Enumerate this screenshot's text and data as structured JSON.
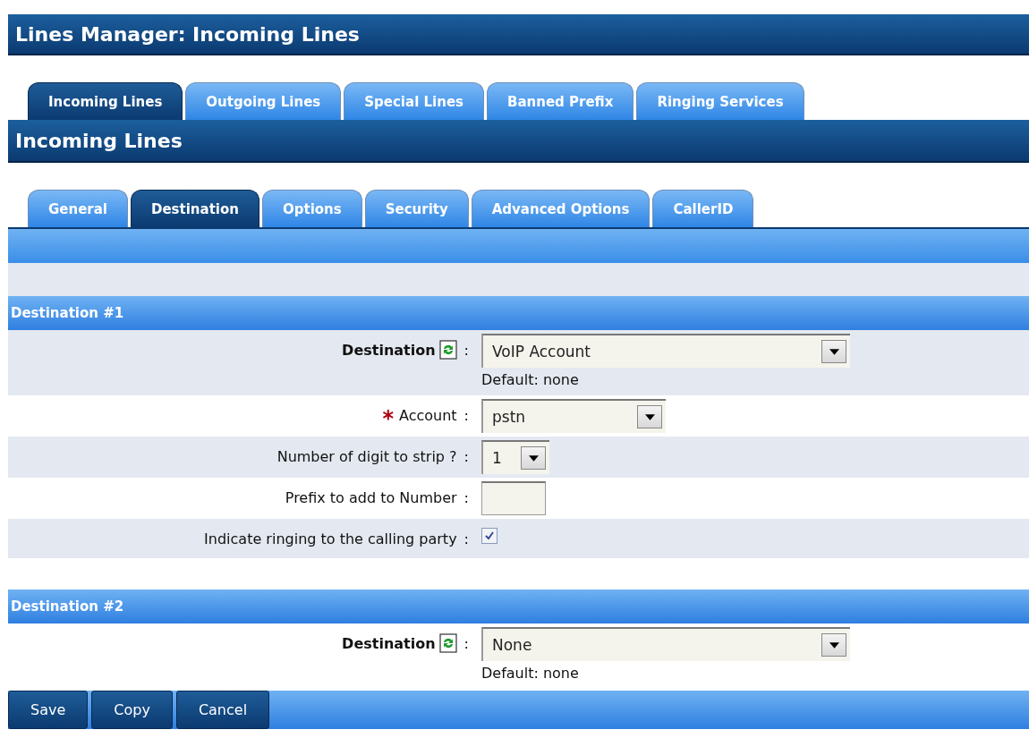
{
  "page_title": "Lines Manager:  Incoming Lines",
  "main_tabs": [
    {
      "label": "Incoming Lines",
      "selected": true
    },
    {
      "label": "Outgoing Lines",
      "selected": false
    },
    {
      "label": "Special Lines",
      "selected": false
    },
    {
      "label": "Banned Prefix",
      "selected": false
    },
    {
      "label": "Ringing Services",
      "selected": false
    }
  ],
  "section_title": "Incoming Lines",
  "sub_tabs": [
    {
      "label": "General",
      "selected": false
    },
    {
      "label": "Destination",
      "selected": true
    },
    {
      "label": "Options",
      "selected": false
    },
    {
      "label": "Security",
      "selected": false
    },
    {
      "label": "Advanced Options",
      "selected": false
    },
    {
      "label": "CallerID",
      "selected": false
    }
  ],
  "destinations": [
    {
      "title": "Destination #1",
      "rows": [
        {
          "kind": "select",
          "label": "Destination",
          "refresh_icon": true,
          "separator": ":",
          "value": "VoIP Account",
          "hint": "Default: none"
        },
        {
          "kind": "select",
          "required_mark": "*",
          "label": "Account",
          "refresh_icon": false,
          "separator": ":",
          "value": "pstn"
        },
        {
          "kind": "select",
          "label": "Number of digit to strip ?",
          "refresh_icon": false,
          "separator": ":",
          "value": "1"
        },
        {
          "kind": "text",
          "label": "Prefix to add to Number",
          "refresh_icon": false,
          "separator": ":"
        },
        {
          "kind": "checkbox",
          "label": "Indicate ringing to the calling party",
          "refresh_icon": false,
          "separator": ":",
          "checked": true
        }
      ]
    },
    {
      "title": "Destination #2",
      "rows": [
        {
          "kind": "select",
          "label": "Destination",
          "refresh_icon": true,
          "separator": ":",
          "value": "None",
          "hint": "Default: none"
        }
      ]
    }
  ],
  "buttons": [
    "Save",
    "Copy",
    "Cancel"
  ]
}
